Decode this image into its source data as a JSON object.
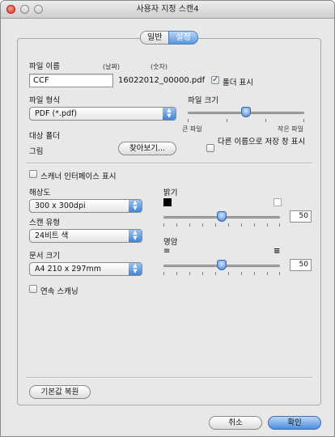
{
  "window": {
    "title": "사용자 지정 스캔4"
  },
  "tabs": [
    {
      "label": "일반",
      "active": false
    },
    {
      "label": "설정",
      "active": true
    }
  ],
  "file_name": {
    "label": "파일 이름",
    "date_hint": "(날짜)",
    "number_hint": "(숫자)",
    "value": "CCF",
    "generated_name": "16022012_00000.pdf",
    "show_folder_label": "폴더 표시",
    "show_folder_checked": true
  },
  "file_type": {
    "label": "파일 형식",
    "selected": "PDF (*.pdf)"
  },
  "file_size": {
    "label": "파일 크기",
    "min_label": "큰 파일",
    "max_label": "작은 파일",
    "level_percent": 50
  },
  "destination": {
    "label": "대상 폴더",
    "value": "그림",
    "browse_label": "찾아보기...",
    "save_as_label": "다른 이름으로 저장 창 표시",
    "save_as_checked": false
  },
  "scanner_ui": {
    "label": "스캐너 인터페이스 표시",
    "checked": false
  },
  "resolution": {
    "label": "해상도",
    "selected": "300 x 300dpi"
  },
  "scan_type": {
    "label": "스캔 유형",
    "selected": "24비트 색"
  },
  "document_size": {
    "label": "문서 크기",
    "selected": "A4 210 x 297mm"
  },
  "brightness": {
    "label": "밝기",
    "value": "50"
  },
  "contrast": {
    "label": "명암",
    "value": "50"
  },
  "continuous": {
    "label": "연속 스캐닝",
    "checked": false
  },
  "restore_defaults_label": "기본값 복원",
  "cancel_label": "취소",
  "ok_label": "확인",
  "colors": {
    "accent": "#4a8ee0",
    "panel": "#e8e8e8"
  }
}
